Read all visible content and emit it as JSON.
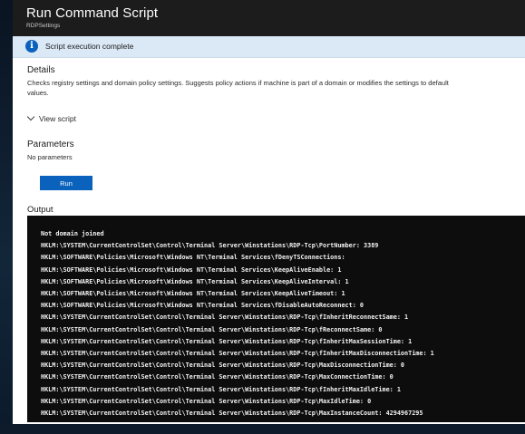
{
  "header": {
    "title": "Run Command Script",
    "subtitle": "RDPSettings"
  },
  "status": {
    "icon": "info-icon",
    "text": "Script execution complete"
  },
  "details": {
    "title": "Details",
    "line1": "Checks registry settings and domain policy settings. Suggests policy actions if machine is part of a domain or modifies the settings to default",
    "line2": "values."
  },
  "view_script": {
    "label": "View script"
  },
  "parameters": {
    "title": "Parameters",
    "value": "No parameters"
  },
  "run_button": {
    "label": "Run"
  },
  "output": {
    "label": "Output",
    "lines": [
      "Not domain joined",
      "HKLM:\\SYSTEM\\CurrentControlSet\\Control\\Terminal Server\\Winstations\\RDP-Tcp\\PortNumber: 3389",
      "HKLM:\\SOFTWARE\\Policies\\Microsoft\\Windows NT\\Terminal Services\\fDenyTSConnections:",
      "HKLM:\\SOFTWARE\\Policies\\Microsoft\\Windows NT\\Terminal Services\\KeepAliveEnable: 1",
      "HKLM:\\SOFTWARE\\Policies\\Microsoft\\Windows NT\\Terminal Services\\KeepAliveInterval: 1",
      "HKLM:\\SOFTWARE\\Policies\\Microsoft\\Windows NT\\Terminal Services\\KeepAliveTimeout: 1",
      "HKLM:\\SOFTWARE\\Policies\\Microsoft\\Windows NT\\Terminal Services\\fDisableAutoReconnect: 0",
      "HKLM:\\SYSTEM\\CurrentControlSet\\Control\\Terminal Server\\Winstations\\RDP-Tcp\\fInheritReconnectSame: 1",
      "HKLM:\\SYSTEM\\CurrentControlSet\\Control\\Terminal Server\\Winstations\\RDP-Tcp\\fReconnectSame: 0",
      "HKLM:\\SYSTEM\\CurrentControlSet\\Control\\Terminal Server\\Winstations\\RDP-Tcp\\fInheritMaxSessionTime: 1",
      "HKLM:\\SYSTEM\\CurrentControlSet\\Control\\Terminal Server\\Winstations\\RDP-Tcp\\fInheritMaxDisconnectionTime: 1",
      "HKLM:\\SYSTEM\\CurrentControlSet\\Control\\Terminal Server\\Winstations\\RDP-Tcp\\MaxDisconnectionTime: 0",
      "HKLM:\\SYSTEM\\CurrentControlSet\\Control\\Terminal Server\\Winstations\\RDP-Tcp\\MaxConnectionTime: 0",
      "HKLM:\\SYSTEM\\CurrentControlSet\\Control\\Terminal Server\\Winstations\\RDP-Tcp\\fInheritMaxIdleTime: 1",
      "HKLM:\\SYSTEM\\CurrentControlSet\\Control\\Terminal Server\\Winstations\\RDP-Tcp\\MaxIdleTime: 0",
      "HKLM:\\SYSTEM\\CurrentControlSet\\Control\\Terminal Server\\Winstations\\RDP-Tcp\\MaxInstanceCount: 4294967295"
    ]
  },
  "colors": {
    "title_bar": "#1c1c1c",
    "status_bar": "#dbe9f7",
    "accent": "#0a62bd",
    "terminal_bg": "#0d0d0d"
  }
}
